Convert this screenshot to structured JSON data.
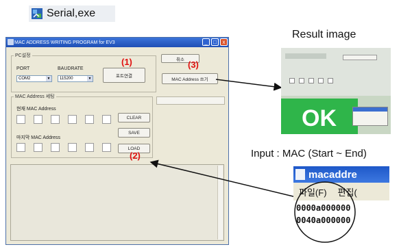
{
  "exe_label": "Serial,exe",
  "window": {
    "title": "MAC ADDRESS WRITING PROGRAM for EV3",
    "buttons": {
      "min": "_",
      "max": "□",
      "close": "x"
    },
    "pc_group": {
      "label": "PC설정",
      "port_label": "PORT",
      "port_value": "COM2",
      "baud_label": "BAUDRATE",
      "baud_value": "115200",
      "connect_button": "포트연결"
    },
    "cancel_button": "취소",
    "write_button": "MAC Address 쓰기",
    "mac_group": {
      "label": "MAC Address 세팅",
      "current_label": "현재 MAC Address",
      "last_label": "마지막 MAC Address",
      "clear_button": "CLEAR",
      "save_button": "SAVE",
      "load_button": "LOAD"
    },
    "markers": {
      "one": "(1)",
      "two": "(2)",
      "three": "(3)"
    }
  },
  "result": {
    "caption": "Result image",
    "ok_text": "OK"
  },
  "input": {
    "caption": "Input : MAC (Start ~ End)",
    "zoom_title": "macaddre",
    "menu_file": "파일(F)",
    "menu_edit": "편집(",
    "line1": "0000a000000",
    "line2": "0040a000000"
  },
  "colors": {
    "titlebar": "#1f4fb5",
    "marker": "#e01010",
    "ok_green": "#2fb54a"
  }
}
